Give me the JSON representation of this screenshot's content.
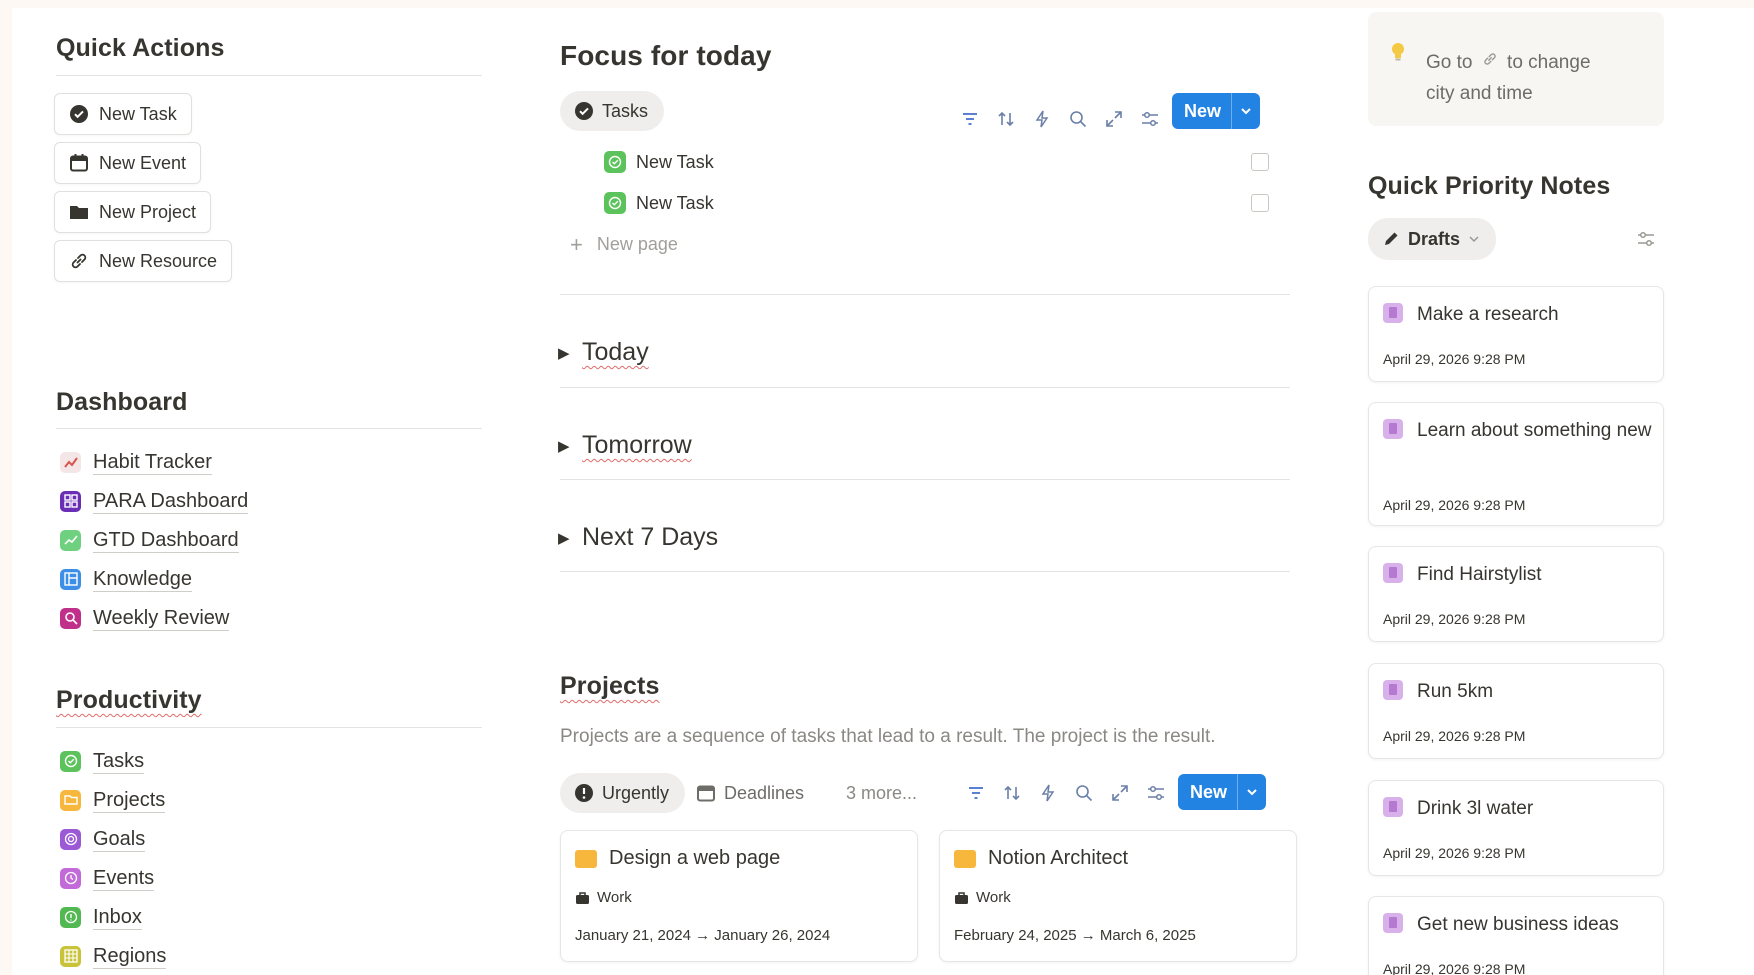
{
  "quick_actions": {
    "title": "Quick Actions",
    "buttons": [
      {
        "label": "New Task",
        "icon": "check-circle-icon"
      },
      {
        "label": "New Event",
        "icon": "calendar-icon"
      },
      {
        "label": "New Project",
        "icon": "folder-icon"
      },
      {
        "label": "New Resource",
        "icon": "link-icon"
      }
    ]
  },
  "dashboard": {
    "title": "Dashboard",
    "items": [
      {
        "label": "Habit Tracker",
        "icon": "chart-trend-icon",
        "color": "#f4e6e6"
      },
      {
        "label": "PARA Dashboard",
        "icon": "grid-icon",
        "color": "#6a2fb5"
      },
      {
        "label": "GTD Dashboard",
        "icon": "trend-icon",
        "color": "#6fd17f"
      },
      {
        "label": "Knowledge",
        "icon": "layout-icon",
        "color": "#3d8ee6"
      },
      {
        "label": "Weekly Review",
        "icon": "search-icon",
        "color": "#c0308a"
      }
    ]
  },
  "productivity": {
    "title": "Productivity",
    "items": [
      {
        "label": "Tasks",
        "icon": "check-icon",
        "color": "#5cc35c"
      },
      {
        "label": "Projects",
        "icon": "folder-icon",
        "color": "#f6b73c"
      },
      {
        "label": "Goals",
        "icon": "target-icon",
        "color": "#9b59d6"
      },
      {
        "label": "Events",
        "icon": "calendar-icon",
        "color": "#c16ad8"
      },
      {
        "label": "Inbox",
        "icon": "inbox-icon",
        "color": "#52b852"
      },
      {
        "label": "Regions",
        "icon": "grid-icon",
        "color": "#c9c33a"
      }
    ]
  },
  "focus": {
    "title": "Focus for today",
    "tab_label": "Tasks",
    "new_label": "New",
    "tasks": [
      {
        "label": "New Task"
      },
      {
        "label": "New Task"
      }
    ],
    "new_page_label": "New page",
    "toggles": [
      {
        "label": "Today"
      },
      {
        "label": "Tomorrow"
      },
      {
        "label": "Next 7 Days"
      }
    ]
  },
  "projects": {
    "title": "Projects",
    "description": "Projects are a sequence of tasks that lead to a result. The project is the result.",
    "tabs": [
      {
        "label": "Urgently",
        "icon": "exclamation-icon"
      },
      {
        "label": "Deadlines",
        "icon": "calendar-icon"
      }
    ],
    "more_label": "3 more...",
    "new_label": "New",
    "cards": [
      {
        "title": "Design a web page",
        "tag": "Work",
        "dates": "January 21, 2024 → January 26, 2024"
      },
      {
        "title": "Notion Architect",
        "tag": "Work",
        "dates": "February 24, 2025 → March 6, 2025"
      }
    ]
  },
  "weather_tip": {
    "line1_a": "Go to",
    "line1_b": "to change",
    "line2": "city and time"
  },
  "notes": {
    "title": "Quick Priority Notes",
    "filter_label": "Drafts",
    "items": [
      {
        "title": "Make a research",
        "date": "April 29, 2026 9:28 PM"
      },
      {
        "title": "Learn about something new",
        "date": "April 29, 2026 9:28 PM"
      },
      {
        "title": "Find Hairstylist",
        "date": "April 29, 2026 9:28 PM"
      },
      {
        "title": "Run 5km",
        "date": "April 29, 2026 9:28 PM"
      },
      {
        "title": "Drink 3l water",
        "date": "April 29, 2026 9:28 PM"
      },
      {
        "title": "Get new business ideas",
        "date": "April 29, 2026 9:28 PM"
      }
    ]
  },
  "colors": {
    "accent": "#2383e2",
    "background": "#fdf8f3",
    "text": "#37352f"
  }
}
